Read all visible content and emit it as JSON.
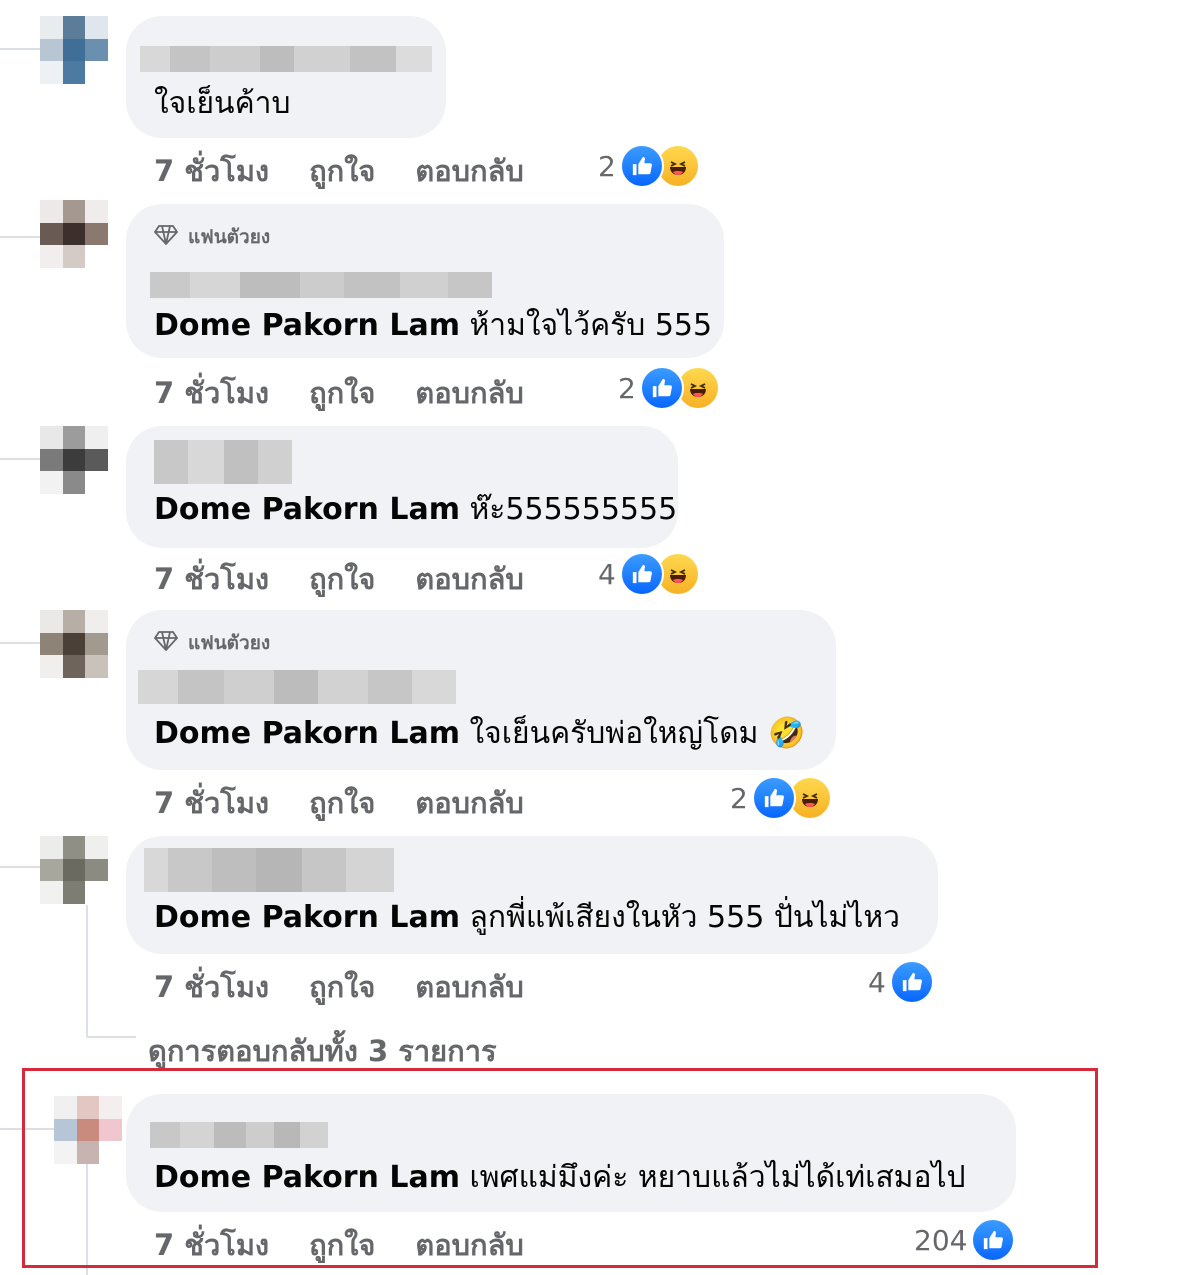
{
  "comments": [
    {
      "badge": "",
      "text": "ใจเย็นค้าบ",
      "mention": "",
      "meta": {
        "time": "7 ชั่วโมง",
        "like": "ถูกใจ",
        "reply": "ตอบกลับ"
      },
      "reaction_count": "2",
      "reactions": [
        "like-icon",
        "haha-icon"
      ]
    },
    {
      "badge": "แฟนตัวยง",
      "mention": "Dome Pakorn Lam",
      "text": "ห้ามใจไว้ครับ 555",
      "meta": {
        "time": "7 ชั่วโมง",
        "like": "ถูกใจ",
        "reply": "ตอบกลับ"
      },
      "reaction_count": "2",
      "reactions": [
        "like-icon",
        "haha-icon"
      ]
    },
    {
      "badge": "",
      "mention": "Dome Pakorn Lam",
      "text": "ห๊ะ555555555",
      "meta": {
        "time": "7 ชั่วโมง",
        "like": "ถูกใจ",
        "reply": "ตอบกลับ"
      },
      "reaction_count": "4",
      "reactions": [
        "like-icon",
        "haha-icon"
      ]
    },
    {
      "badge": "แฟนตัวยง",
      "mention": "Dome Pakorn Lam",
      "text": "ใจเย็นครับพ่อใหญ่โดม",
      "emoji": "🤣",
      "meta": {
        "time": "7 ชั่วโมง",
        "like": "ถูกใจ",
        "reply": "ตอบกลับ"
      },
      "reaction_count": "2",
      "reactions": [
        "like-icon",
        "haha-icon"
      ]
    },
    {
      "badge": "",
      "mention": "Dome Pakorn Lam",
      "text": "ลูกพี่แพ้เสียงในหัว 555 ปั่นไม่ไหว",
      "meta": {
        "time": "7 ชั่วโมง",
        "like": "ถูกใจ",
        "reply": "ตอบกลับ"
      },
      "reaction_count": "4",
      "reactions": [
        "like-icon"
      ]
    },
    {
      "badge": "",
      "mention": "Dome Pakorn Lam",
      "text": "เพศแม่มึงค่ะ หยาบแล้วไม่ได้เท่เสมอไป",
      "meta": {
        "time": "7 ชั่วโมง",
        "like": "ถูกใจ",
        "reply": "ตอบกลับ"
      },
      "reaction_count": "204",
      "reactions": [
        "like-icon"
      ]
    }
  ],
  "view_replies": "ดูการตอบกลับทั้ง 3 รายการ",
  "colors": {
    "like": "#0866ff",
    "haha": "#f7b125",
    "bubble": "#f0f2f5",
    "meta": "#65676b",
    "highlight": "#d42a3a"
  }
}
